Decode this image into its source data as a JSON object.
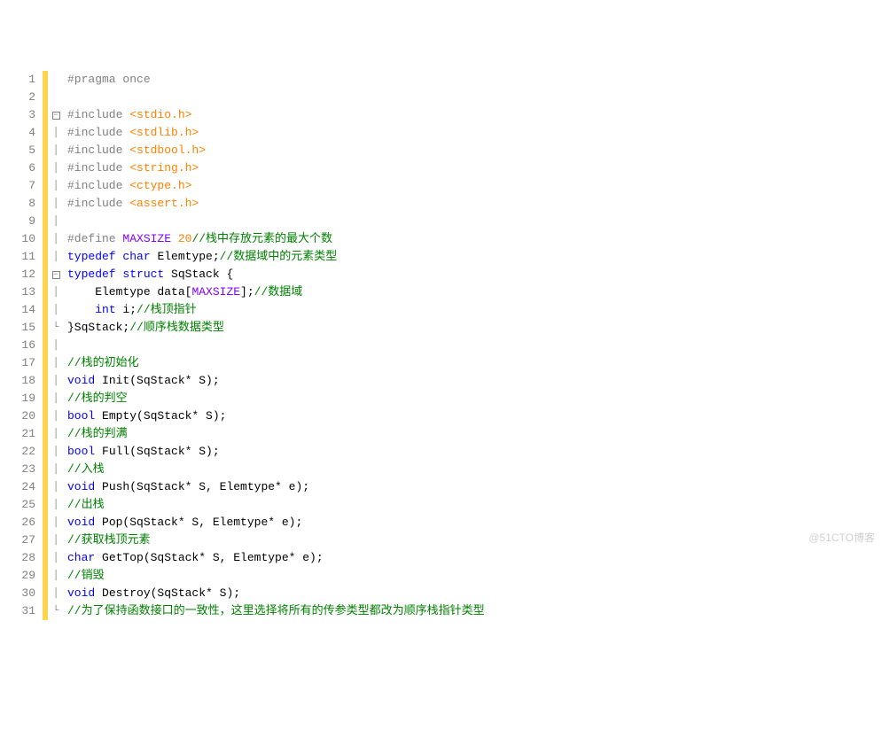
{
  "watermark": "@51CTO博客",
  "lines": [
    {
      "n": 1,
      "marker": true,
      "fold": "",
      "tokens": [
        {
          "c": "kw-gray",
          "t": "#pragma once"
        }
      ]
    },
    {
      "n": 2,
      "marker": true,
      "fold": "",
      "tokens": []
    },
    {
      "n": 3,
      "marker": true,
      "fold": "minus",
      "tokens": [
        {
          "c": "kw-gray",
          "t": "#include "
        },
        {
          "c": "angle",
          "t": "<stdio.h>"
        }
      ]
    },
    {
      "n": 4,
      "marker": true,
      "fold": "bar",
      "tokens": [
        {
          "c": "kw-gray",
          "t": "#include "
        },
        {
          "c": "angle",
          "t": "<stdlib.h>"
        }
      ]
    },
    {
      "n": 5,
      "marker": true,
      "fold": "bar",
      "tokens": [
        {
          "c": "kw-gray",
          "t": "#include "
        },
        {
          "c": "angle",
          "t": "<stdbool.h>"
        }
      ]
    },
    {
      "n": 6,
      "marker": true,
      "fold": "bar",
      "tokens": [
        {
          "c": "kw-gray",
          "t": "#include "
        },
        {
          "c": "angle",
          "t": "<string.h>"
        }
      ]
    },
    {
      "n": 7,
      "marker": true,
      "fold": "bar",
      "tokens": [
        {
          "c": "kw-gray",
          "t": "#include "
        },
        {
          "c": "angle",
          "t": "<ctype.h>"
        }
      ]
    },
    {
      "n": 8,
      "marker": true,
      "fold": "bar",
      "tokens": [
        {
          "c": "kw-gray",
          "t": "#include "
        },
        {
          "c": "angle",
          "t": "<assert.h>"
        }
      ]
    },
    {
      "n": 9,
      "marker": true,
      "fold": "bar",
      "tokens": []
    },
    {
      "n": 10,
      "marker": true,
      "fold": "bar",
      "tokens": [
        {
          "c": "kw-gray",
          "t": "#define "
        },
        {
          "c": "kw-purple",
          "t": "MAXSIZE"
        },
        {
          "c": "plain",
          "t": " "
        },
        {
          "c": "num",
          "t": "20"
        },
        {
          "c": "cmt",
          "t": "//栈中存放元素的最大个数"
        }
      ]
    },
    {
      "n": 11,
      "marker": true,
      "fold": "bar",
      "tokens": [
        {
          "c": "kw-blue",
          "t": "typedef"
        },
        {
          "c": "plain",
          "t": " "
        },
        {
          "c": "kw-blue",
          "t": "char"
        },
        {
          "c": "plain",
          "t": " Elemtype;"
        },
        {
          "c": "cmt",
          "t": "//数据域中的元素类型"
        }
      ]
    },
    {
      "n": 12,
      "marker": true,
      "fold": "minus",
      "tokens": [
        {
          "c": "kw-blue",
          "t": "typedef"
        },
        {
          "c": "plain",
          "t": " "
        },
        {
          "c": "kw-blue",
          "t": "struct"
        },
        {
          "c": "plain",
          "t": " SqStack {"
        }
      ]
    },
    {
      "n": 13,
      "marker": true,
      "fold": "bar",
      "tokens": [
        {
          "c": "plain",
          "t": "    Elemtype data["
        },
        {
          "c": "kw-purple",
          "t": "MAXSIZE"
        },
        {
          "c": "plain",
          "t": "];"
        },
        {
          "c": "cmt",
          "t": "//数据域"
        }
      ]
    },
    {
      "n": 14,
      "marker": true,
      "fold": "bar",
      "tokens": [
        {
          "c": "plain",
          "t": "    "
        },
        {
          "c": "kw-blue",
          "t": "int"
        },
        {
          "c": "plain",
          "t": " i;"
        },
        {
          "c": "cmt",
          "t": "//栈顶指针"
        }
      ]
    },
    {
      "n": 15,
      "marker": true,
      "fold": "end",
      "tokens": [
        {
          "c": "plain",
          "t": "}SqStack;"
        },
        {
          "c": "cmt",
          "t": "//顺序栈数据类型"
        }
      ]
    },
    {
      "n": 16,
      "marker": true,
      "fold": "bar",
      "tokens": []
    },
    {
      "n": 17,
      "marker": true,
      "fold": "bar",
      "tokens": [
        {
          "c": "cmt",
          "t": "//栈的初始化"
        }
      ]
    },
    {
      "n": 18,
      "marker": true,
      "fold": "bar",
      "tokens": [
        {
          "c": "kw-blue",
          "t": "void"
        },
        {
          "c": "plain",
          "t": " Init(SqStack* S);"
        }
      ]
    },
    {
      "n": 19,
      "marker": true,
      "fold": "bar",
      "tokens": [
        {
          "c": "cmt",
          "t": "//栈的判空"
        }
      ]
    },
    {
      "n": 20,
      "marker": true,
      "fold": "bar",
      "tokens": [
        {
          "c": "kw-blue",
          "t": "bool"
        },
        {
          "c": "plain",
          "t": " Empty(SqStack* S);"
        }
      ]
    },
    {
      "n": 21,
      "marker": true,
      "fold": "bar",
      "tokens": [
        {
          "c": "cmt",
          "t": "//栈的判满"
        }
      ]
    },
    {
      "n": 22,
      "marker": true,
      "fold": "bar",
      "tokens": [
        {
          "c": "kw-blue",
          "t": "bool"
        },
        {
          "c": "plain",
          "t": " Full(SqStack* S);"
        }
      ]
    },
    {
      "n": 23,
      "marker": true,
      "fold": "bar",
      "tokens": [
        {
          "c": "cmt",
          "t": "//入栈"
        }
      ]
    },
    {
      "n": 24,
      "marker": true,
      "fold": "bar",
      "tokens": [
        {
          "c": "kw-blue",
          "t": "void"
        },
        {
          "c": "plain",
          "t": " Push(SqStack* S, Elemtype* e);"
        }
      ]
    },
    {
      "n": 25,
      "marker": true,
      "fold": "bar",
      "tokens": [
        {
          "c": "cmt",
          "t": "//出栈"
        }
      ]
    },
    {
      "n": 26,
      "marker": true,
      "fold": "bar",
      "tokens": [
        {
          "c": "kw-blue",
          "t": "void"
        },
        {
          "c": "plain",
          "t": " Pop(SqStack* S, Elemtype* e);"
        }
      ]
    },
    {
      "n": 27,
      "marker": true,
      "fold": "bar",
      "tokens": [
        {
          "c": "cmt",
          "t": "//获取栈顶元素"
        }
      ]
    },
    {
      "n": 28,
      "marker": true,
      "fold": "bar",
      "tokens": [
        {
          "c": "kw-blue",
          "t": "char"
        },
        {
          "c": "plain",
          "t": " GetTop(SqStack* S, Elemtype* e);"
        }
      ]
    },
    {
      "n": 29,
      "marker": true,
      "fold": "bar",
      "tokens": [
        {
          "c": "cmt",
          "t": "//销毁"
        }
      ]
    },
    {
      "n": 30,
      "marker": true,
      "fold": "bar",
      "tokens": [
        {
          "c": "kw-blue",
          "t": "void"
        },
        {
          "c": "plain",
          "t": " Destroy(SqStack* S);"
        }
      ]
    },
    {
      "n": 31,
      "marker": true,
      "fold": "end",
      "tokens": [
        {
          "c": "cmt",
          "t": "//为了保持函数接口的一致性，这里选择将所有的传参类型都改为顺序栈指针类型"
        }
      ]
    }
  ]
}
